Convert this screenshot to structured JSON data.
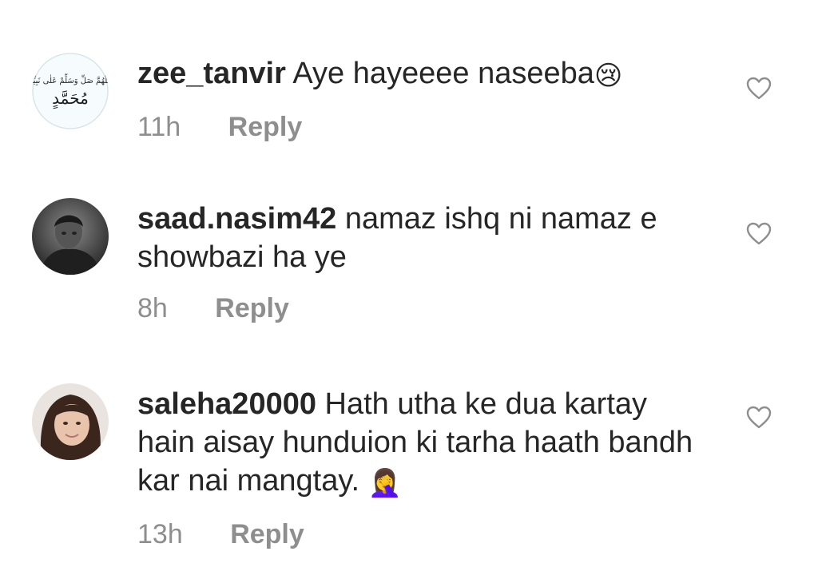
{
  "comments": [
    {
      "username": "zee_tanvir",
      "text": " Aye hayeeee naseeba",
      "emoji": "😢",
      "time": "11h",
      "reply_label": "Reply",
      "avatar_lines": [
        "اللّٰهُمَّ صَلِّ وَسَلِّمْ عَلٰى نَبِيِّنَا",
        "مُحَمَّدٍ"
      ]
    },
    {
      "username": "saad.nasim42",
      "text": " namaz ishq ni namaz e showbazi ha ye",
      "emoji": "",
      "time": "8h",
      "reply_label": "Reply"
    },
    {
      "username": "saleha20000",
      "text": " Hath utha ke dua kartay hain aisay hunduion ki tarha haath bandh kar nai mangtay. ",
      "emoji": "🤦‍♀️",
      "time": "13h",
      "reply_label": "Reply"
    }
  ],
  "colors": {
    "text": "#262626",
    "secondary": "#8e8e8e",
    "icon_stroke": "#8e8e8e"
  },
  "icons": [
    "heart-icon",
    "heart-icon",
    "heart-icon"
  ]
}
